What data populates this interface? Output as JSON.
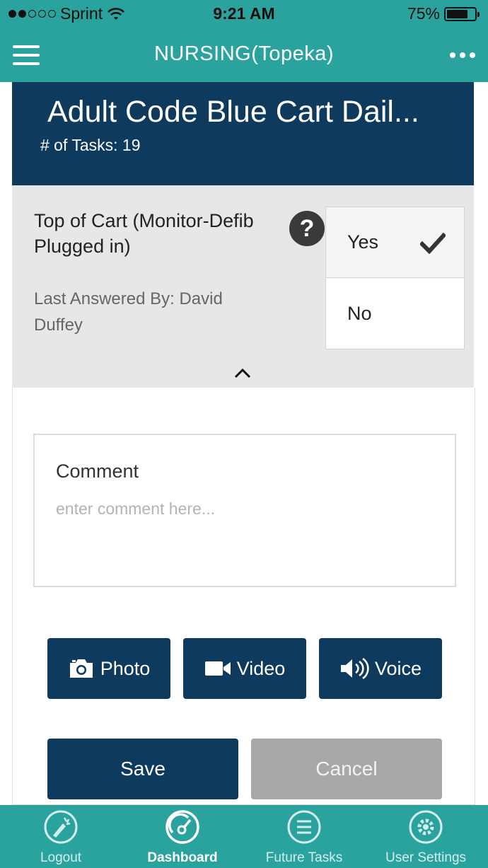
{
  "status_bar": {
    "carrier": "Sprint",
    "time": "9:21 AM",
    "battery": "75%",
    "battery_level": 0.75,
    "signal_bars_filled": 2,
    "signal_bars_total": 5
  },
  "app_bar": {
    "title": "NURSING(Topeka)",
    "menu_icon": "hamburger-menu-icon",
    "more_icon": "more-horizontal-icon"
  },
  "task": {
    "title": "Adult Code Blue Cart Dail...",
    "count_label": "# of Tasks: 19"
  },
  "question": {
    "text": "Top of Cart (Monitor-Defib Plugged in)",
    "help_glyph": "?",
    "last_answered": "Last Answered By: David Duffey",
    "options": [
      {
        "label": "Yes",
        "selected": true
      },
      {
        "label": "No",
        "selected": false
      }
    ]
  },
  "comment": {
    "label": "Comment",
    "placeholder": "enter comment here...",
    "value": ""
  },
  "media_buttons": {
    "photo": "Photo",
    "video": "Video",
    "voice": "Voice"
  },
  "actions": {
    "save": "Save",
    "cancel": "Cancel"
  },
  "tabs": [
    {
      "label": "Logout",
      "icon": "logout-icon",
      "active": false
    },
    {
      "label": "Dashboard",
      "icon": "dashboard-gauge-icon",
      "active": true
    },
    {
      "label": "Future Tasks",
      "icon": "future-tasks-list-icon",
      "active": false
    },
    {
      "label": "User Settings",
      "icon": "settings-gear-icon",
      "active": false
    }
  ],
  "colors": {
    "teal": "#2aa39e",
    "navy": "#0e3a5e",
    "gray_panel": "#e7e7e7",
    "cancel_gray": "#a8a8a8"
  }
}
